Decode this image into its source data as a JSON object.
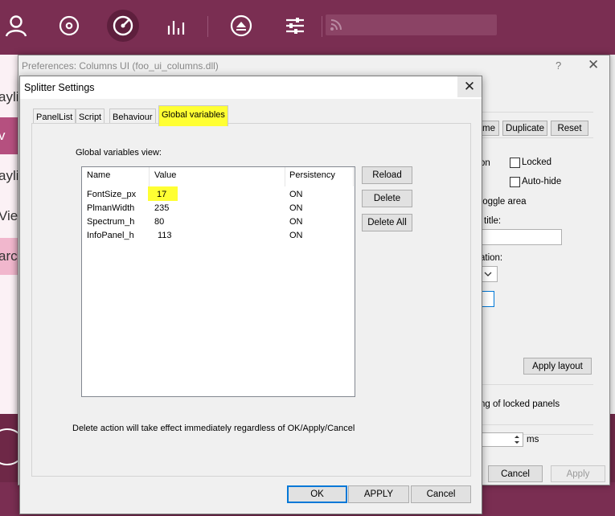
{
  "app_toolbar": {
    "icons": [
      "user-icon",
      "target-icon",
      "gauge-icon",
      "equalizer-icon",
      "eject-icon",
      "sliders-icon",
      "rss-icon"
    ]
  },
  "left_strip": {
    "items": [
      {
        "text": "aylis"
      },
      {
        "text": "v"
      },
      {
        "text": "aylis"
      },
      {
        "text": " Vie"
      },
      {
        "text": "arch"
      }
    ]
  },
  "pref_window": {
    "title": "Preferences: Columns UI (foo_ui_columns.dll)",
    "help": "?",
    "close": "✕",
    "buttons": {
      "rename_partial": "me",
      "duplicate": "Duplicate",
      "reset": "Reset"
    },
    "option_partial": "on",
    "locked_label": "Locked",
    "autohide_label": "Auto-hide",
    "toggle_area_partial": "toggle area",
    "title_partial": "title:",
    "ation_partial": "ation:",
    "apply_layout": "Apply layout",
    "locked_panels_partial": "ng of locked panels",
    "ms_label": "ms",
    "cancel": "Cancel",
    "apply": "Apply"
  },
  "dialog": {
    "title": "Splitter Settings",
    "close": "✕",
    "tabs": [
      {
        "label": "PanelList"
      },
      {
        "label": "Script"
      },
      {
        "label": "Behaviour"
      },
      {
        "label": "Global variables"
      }
    ],
    "view_label": "Global variables view:",
    "columns": {
      "name": "Name",
      "value": "Value",
      "persistency": "Persistency"
    },
    "rows": [
      {
        "name": "FontSize_px",
        "value": "17",
        "persistency": "ON"
      },
      {
        "name": "PlmanWidth",
        "value": "235",
        "persistency": "ON"
      },
      {
        "name": "Spectrum_h",
        "value": "80",
        "persistency": "ON"
      },
      {
        "name": "InfoPanel_h",
        "value": "113",
        "persistency": "ON"
      }
    ],
    "side_buttons": {
      "reload": "Reload",
      "delete": "Delete",
      "delete_all": "Delete All"
    },
    "note": "Delete action will take effect immediately regardless of OK/Apply/Cancel",
    "ok": "OK",
    "apply": "APPLY",
    "cancel": "Cancel",
    "highlight_color": "#ffff33"
  },
  "colors": {
    "toolbar": "#7a2e52",
    "selected_item": "#b5507f",
    "highlight": "#ffff33",
    "focus_border": "#0078d7"
  }
}
